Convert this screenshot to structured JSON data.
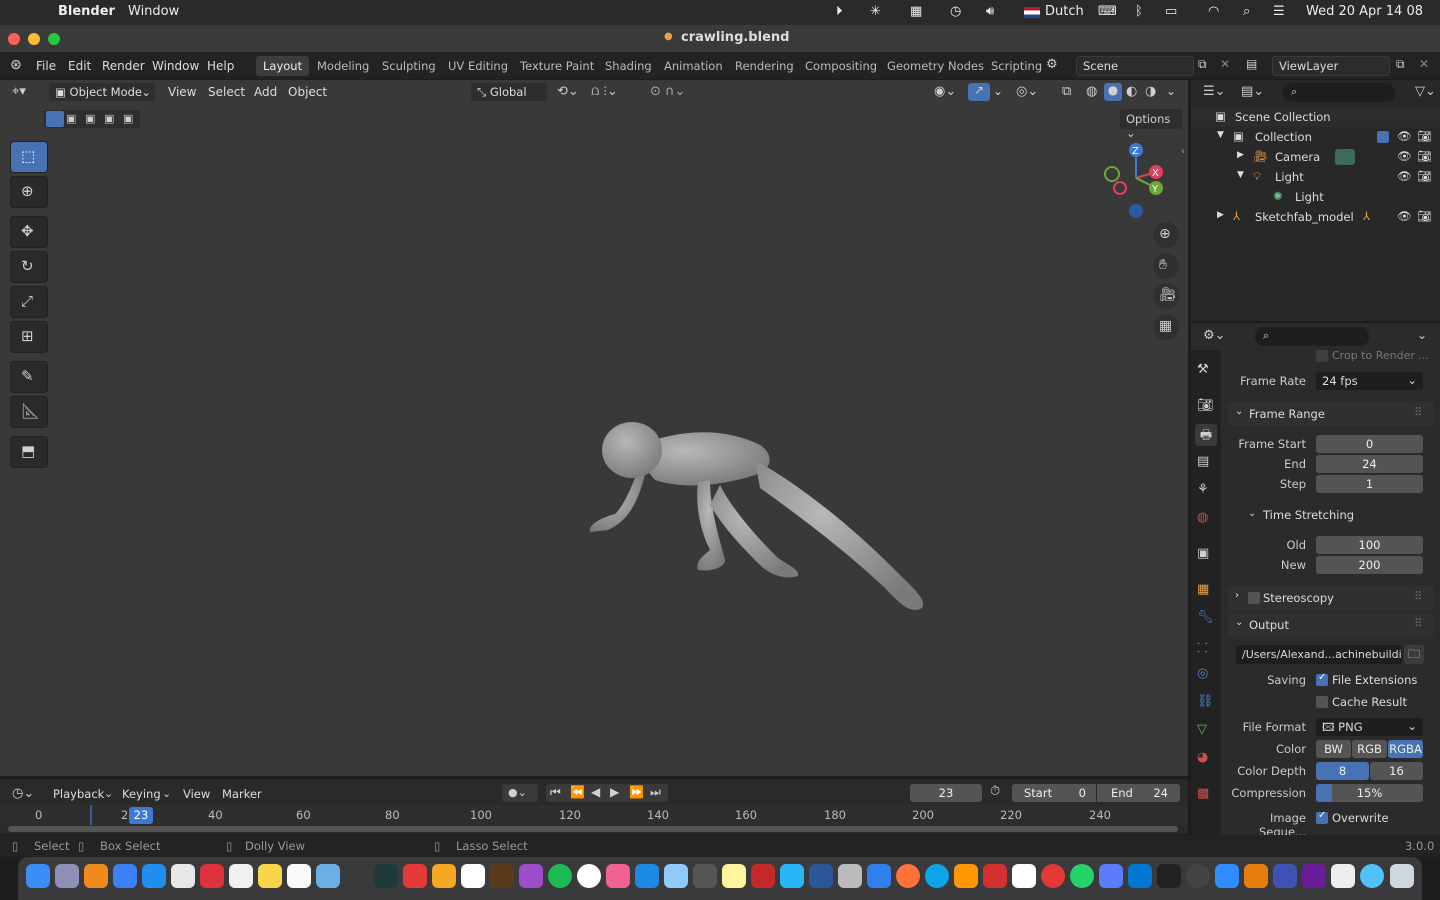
{
  "macos": {
    "app_name": "Blender",
    "menu_window": "Window",
    "language": "Dutch",
    "datetime": "Wed 20 Apr  14 08"
  },
  "window": {
    "title": "crawling.blend"
  },
  "topbar": {
    "menus": [
      "File",
      "Edit",
      "Render",
      "Window",
      "Help"
    ],
    "workspaces": [
      "Layout",
      "Modeling",
      "Sculpting",
      "UV Editing",
      "Texture Paint",
      "Shading",
      "Animation",
      "Rendering",
      "Compositing",
      "Geometry Nodes",
      "Scripting"
    ],
    "active_workspace": "Layout",
    "scene": "Scene",
    "view_layer": "ViewLayer"
  },
  "viewport_header": {
    "mode": "Object Mode",
    "menus": [
      "View",
      "Select",
      "Add",
      "Object"
    ],
    "orientation": "Global",
    "options_label": "Options"
  },
  "outliner": {
    "rows": [
      {
        "label": "Scene Collection",
        "indent": 0
      },
      {
        "label": "Collection",
        "indent": 1
      },
      {
        "label": "Camera",
        "indent": 2
      },
      {
        "label": "Light",
        "indent": 2
      },
      {
        "label": "Light",
        "indent": 3
      },
      {
        "label": "Sketchfab_model",
        "indent": 1
      }
    ]
  },
  "properties": {
    "crop_label": "Crop to Render ...",
    "frame_rate_label": "Frame Rate",
    "frame_rate_value": "24 fps",
    "frame_range_title": "Frame Range",
    "frame_start_label": "Frame Start",
    "frame_start": "0",
    "end_label": "End",
    "end": "24",
    "step_label": "Step",
    "step": "1",
    "time_stretching_title": "Time Stretching",
    "old_label": "Old",
    "old": "100",
    "new_label": "New",
    "new": "200",
    "stereoscopy_title": "Stereoscopy",
    "output_title": "Output",
    "output_path": "/Users/Alexand...achinebuilding/",
    "saving_label": "Saving",
    "file_extensions_label": "File Extensions",
    "cache_result_label": "Cache Result",
    "file_format_label": "File Format",
    "file_format": "PNG",
    "color_label": "Color",
    "color_options": [
      "BW",
      "RGB",
      "RGBA"
    ],
    "color_selected": "RGBA",
    "color_depth_label": "Color Depth",
    "color_depth_options": [
      "8",
      "16"
    ],
    "color_depth_selected": "8",
    "compression_label": "Compression",
    "compression": "15%",
    "compression_fraction": 0.15,
    "image_sequence_label": "Image Seque...",
    "overwrite_label": "Overwrite"
  },
  "timeline": {
    "menus": [
      "Playback",
      "Keying",
      "View",
      "Marker"
    ],
    "current_frame": "23",
    "start_label": "Start",
    "start": "0",
    "end_label": "End",
    "end": "24",
    "ticks": [
      "0",
      "2",
      "40",
      "60",
      "80",
      "100",
      "120",
      "140",
      "160",
      "180",
      "200",
      "220",
      "240"
    ],
    "playhead": "23"
  },
  "statusbar": {
    "select": "Select",
    "box_select": "Box Select",
    "dolly_view": "Dolly View",
    "lasso_select": "Lasso Select",
    "version": "3.0.0"
  },
  "gizmo": {
    "z": "Z",
    "x": "X",
    "y": "Y"
  },
  "colors": {
    "accent": "#4772b3",
    "viewport": "#393939"
  }
}
